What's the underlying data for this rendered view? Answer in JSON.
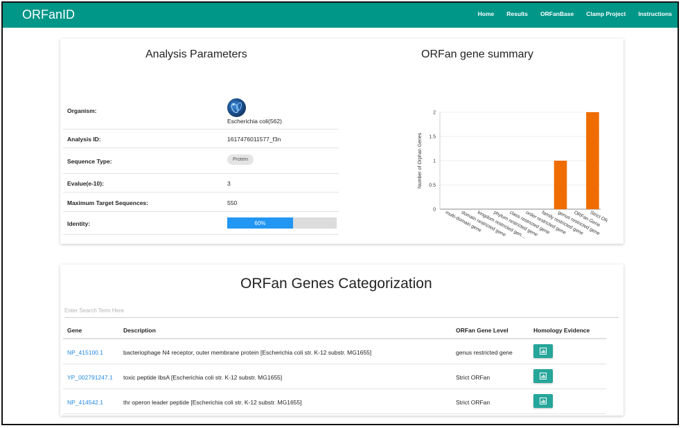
{
  "navbar": {
    "brand": "ORFanID",
    "links": [
      "Home",
      "Results",
      "ORFanBase",
      "Clamp Project",
      "Instructions"
    ]
  },
  "params": {
    "title": "Analysis Parameters",
    "organism_label": "Organism:",
    "organism_value": "Escherichia coli(562)",
    "analysis_id_label": "Analysis ID:",
    "analysis_id_value": "1617476011577_f3n",
    "sequence_type_label": "Sequence Type:",
    "sequence_type_value": "Protein",
    "evalue_label": "Evalue(e-10):",
    "evalue_value": "3",
    "max_target_label": "Maximum Target Sequences:",
    "max_target_value": "550",
    "identity_label": "Identity:",
    "identity_value": "60%",
    "identity_fraction": 0.6
  },
  "summary": {
    "title": "ORFan gene summary"
  },
  "chart_data": {
    "type": "bar",
    "title": "ORFan gene summary",
    "xlabel": "",
    "ylabel": "Number of Orphan Genes",
    "categories": [
      "multi-domain gene",
      "domain restricted gene",
      "kingdom restricted gene",
      "phylum restricted gene",
      "class restricted gene",
      "order restricted gene",
      "family restricted gene",
      "genus restricted gene",
      "ORFan Gene",
      "Strict ORFan"
    ],
    "category_labels_shown": [
      "multi-domain gene",
      "domain restricted gene",
      "kingdom restricted gen…",
      "phylum restricted gene",
      "class restricted gene",
      "order restricted gene",
      "family restricted gene",
      "genus restricted gene",
      "ORFan Gene",
      "Strict ORFan"
    ],
    "values": [
      0,
      0,
      0,
      0,
      0,
      0,
      0,
      1,
      0,
      2
    ],
    "ylim": [
      0,
      2
    ],
    "yticks": [
      "0",
      "0.5",
      "1",
      "1.5",
      "2"
    ],
    "color": "#ef6c00",
    "grid": true
  },
  "genes": {
    "title": "ORFan Genes Categorization",
    "search_placeholder": "Enter Search Term Here",
    "columns": [
      "Gene",
      "Description",
      "ORFan Gene Level",
      "Homology Evidence"
    ],
    "rows": [
      {
        "gene": "NP_415100.1",
        "description": "bacteriophage N4 receptor, outer membrane protein [Escherichia coli str. K-12 substr. MG1655]",
        "level": "genus restricted gene"
      },
      {
        "gene": "YP_002791247.1",
        "description": "toxic peptide IbsA [Escherichia coli str. K-12 substr. MG1655]",
        "level": "Strict ORFan"
      },
      {
        "gene": "NP_414542.1",
        "description": "thr operon leader peptide [Escherichia coli str. K-12 substr. MG1655]",
        "level": "Strict ORFan"
      }
    ]
  },
  "icons": {
    "evidence_button_icon": "chart-icon",
    "organism_avatar": "bacteria-image"
  },
  "colors": {
    "navbar": "#009688",
    "bar": "#ef6c00",
    "progress": "#2196f3",
    "button": "#26a69a",
    "link": "#1e88e5"
  }
}
